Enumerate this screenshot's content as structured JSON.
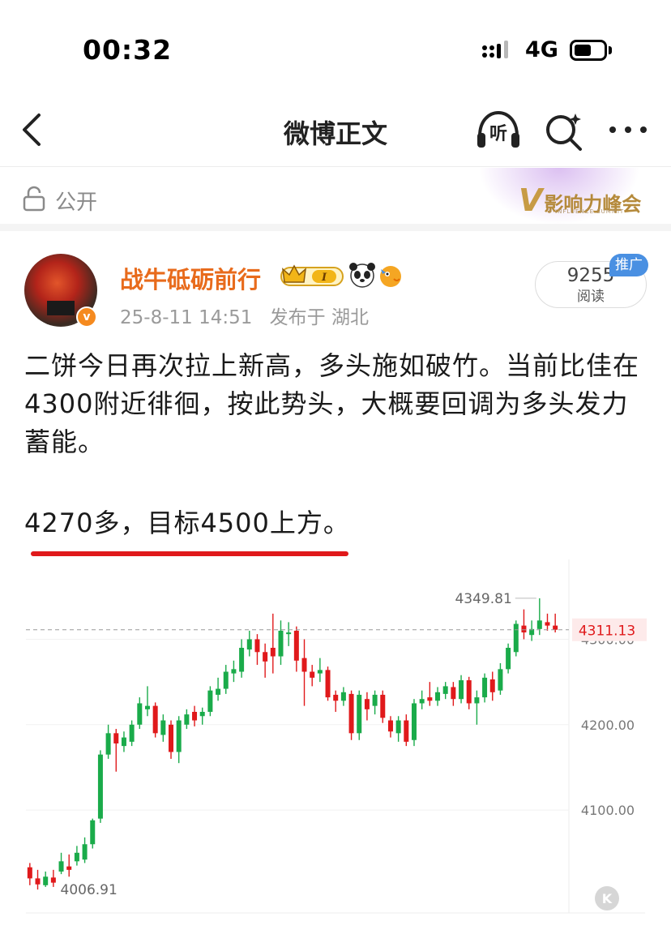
{
  "status_bar": {
    "time": "00:32",
    "network": "4G"
  },
  "nav": {
    "title": "微博正文",
    "listen_label": "听"
  },
  "visibility": {
    "label": "公开",
    "badge": "影响力峰会",
    "badge_sub": "V INFLUENCE SUMMIT"
  },
  "post": {
    "author": "战牛砥砺前行",
    "timestamp": "25-8-11 14:51",
    "location": "发布于 湖北",
    "reads": {
      "count": "9255",
      "label": "阅读"
    },
    "promo_tag": "推广",
    "text_line1": "二饼今日再次拉上新高，多头施如破竹。当前比佳在4300附近徘徊，按此势头，大概要回调为多头发力蓄能。",
    "text_line2": "4270多，目标4500上方。"
  },
  "colors": {
    "up": "#e0191b",
    "down": "#1aab4a",
    "author": "#e86b1c",
    "underline": "#e0191b",
    "accent_blue": "#4a90e2"
  },
  "icons": [
    "back-icon",
    "listen-icon",
    "search-icon",
    "more-icon",
    "lock-icon",
    "crown-badge-icon",
    "panda-icon",
    "fish-icon",
    "verified-icon",
    "k-icon"
  ],
  "chart_data": {
    "type": "candlestick",
    "high_label": "4349.81",
    "low_label": "4006.91",
    "current_label": "4311.13",
    "current_price": 4311.13,
    "y_ticks": [
      "4300.00",
      "4200.00",
      "4100.00"
    ],
    "y_tick_values": [
      4300,
      4200,
      4100
    ],
    "ylim": [
      3990,
      4365
    ],
    "candles": [
      [
        4033,
        4020,
        4038,
        4012
      ],
      [
        4020,
        4013,
        4030,
        4006.91
      ],
      [
        4012,
        4022,
        4028,
        4010
      ],
      [
        4021,
        4015,
        4030,
        4010
      ],
      [
        4028,
        4040,
        4050,
        4025
      ],
      [
        4034,
        4030,
        4048,
        4022
      ],
      [
        4040,
        4050,
        4058,
        4035
      ],
      [
        4042,
        4060,
        4068,
        4038
      ],
      [
        4060,
        4088,
        4090,
        4055
      ],
      [
        4090,
        4165,
        4170,
        4085
      ],
      [
        4165,
        4190,
        4200,
        4160
      ],
      [
        4190,
        4178,
        4195,
        4145
      ],
      [
        4175,
        4185,
        4192,
        4168
      ],
      [
        4180,
        4200,
        4205,
        4175
      ],
      [
        4200,
        4225,
        4232,
        4195
      ],
      [
        4218,
        4222,
        4245,
        4210
      ],
      [
        4222,
        4190,
        4226,
        4185
      ],
      [
        4188,
        4205,
        4212,
        4180
      ],
      [
        4200,
        4168,
        4205,
        4160
      ],
      [
        4168,
        4205,
        4210,
        4155
      ],
      [
        4200,
        4212,
        4218,
        4195
      ],
      [
        4215,
        4205,
        4222,
        4198
      ],
      [
        4210,
        4215,
        4220,
        4200
      ],
      [
        4215,
        4240,
        4245,
        4210
      ],
      [
        4235,
        4242,
        4255,
        4228
      ],
      [
        4242,
        4262,
        4270,
        4236
      ],
      [
        4260,
        4265,
        4275,
        4250
      ],
      [
        4262,
        4290,
        4300,
        4255
      ],
      [
        4288,
        4300,
        4310,
        4280
      ],
      [
        4300,
        4285,
        4306,
        4270
      ],
      [
        4285,
        4274,
        4295,
        4255
      ],
      [
        4290,
        4280,
        4330,
        4260
      ],
      [
        4280,
        4310,
        4322,
        4270
      ],
      [
        4306,
        4308,
        4320,
        4292
      ],
      [
        4310,
        4275,
        4315,
        4262
      ],
      [
        4278,
        4262,
        4300,
        4222
      ],
      [
        4262,
        4255,
        4270,
        4245
      ],
      [
        4260,
        4264,
        4278,
        4250
      ],
      [
        4264,
        4232,
        4268,
        4228
      ],
      [
        4235,
        4228,
        4240,
        4215
      ],
      [
        4228,
        4238,
        4244,
        4222
      ],
      [
        4236,
        4190,
        4240,
        4182
      ],
      [
        4190,
        4235,
        4240,
        4182
      ],
      [
        4230,
        4218,
        4238,
        4205
      ],
      [
        4222,
        4235,
        4240,
        4212
      ],
      [
        4235,
        4208,
        4240,
        4202
      ],
      [
        4205,
        4192,
        4210,
        4185
      ],
      [
        4190,
        4205,
        4210,
        4180
      ],
      [
        4205,
        4180,
        4212,
        4175
      ],
      [
        4182,
        4225,
        4230,
        4175
      ],
      [
        4225,
        4230,
        4240,
        4218
      ],
      [
        4232,
        4228,
        4250,
        4222
      ],
      [
        4228,
        4238,
        4244,
        4222
      ],
      [
        4236,
        4245,
        4250,
        4230
      ],
      [
        4244,
        4230,
        4250,
        4222
      ],
      [
        4230,
        4252,
        4258,
        4225
      ],
      [
        4252,
        4225,
        4256,
        4218
      ],
      [
        4225,
        4232,
        4240,
        4200
      ],
      [
        4232,
        4255,
        4260,
        4226
      ],
      [
        4253,
        4238,
        4262,
        4228
      ],
      [
        4240,
        4265,
        4272,
        4235
      ],
      [
        4265,
        4290,
        4295,
        4260
      ],
      [
        4285,
        4318,
        4322,
        4280
      ],
      [
        4316,
        4308,
        4335,
        4300
      ],
      [
        4305,
        4312,
        4322,
        4298
      ],
      [
        4312,
        4322,
        4348,
        4305
      ],
      [
        4320,
        4316,
        4330,
        4310
      ],
      [
        4316,
        4311.13,
        4330,
        4308
      ]
    ]
  }
}
